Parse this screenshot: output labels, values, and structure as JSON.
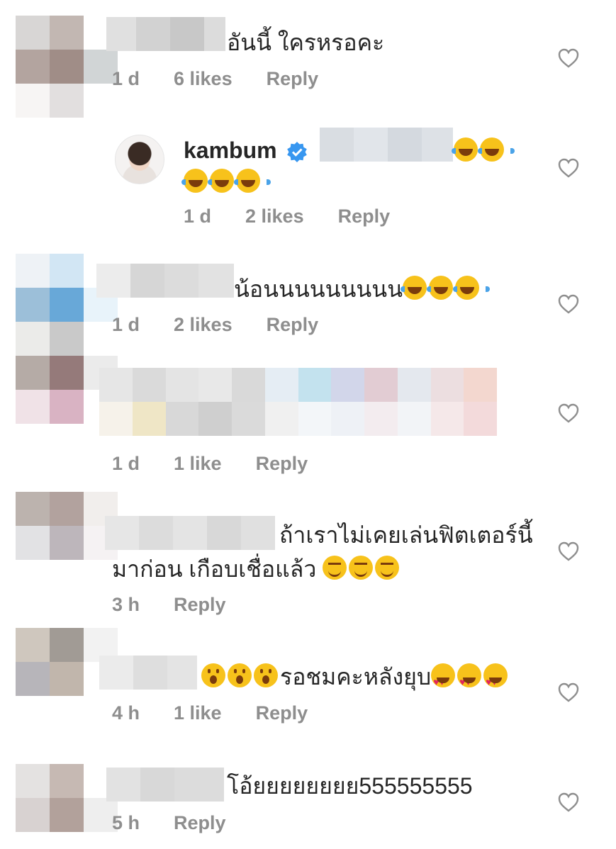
{
  "comments": [
    {
      "avatar_colors": [
        "#d8d6d5",
        "#c2b7b2",
        "#ffffff",
        "#b3a49f",
        "#a08d87",
        "#d1d5d6",
        "#f7f5f4",
        "#e2dfdf",
        "#ffffff"
      ],
      "name_blur_colors": [
        "#e0e0e0",
        "#d2d2d2",
        "#c8c8c8",
        "#dcdcdc"
      ],
      "text": "อันนี้ ใครหรอคะ",
      "time": "1 d",
      "likes": "6 likes",
      "reply": "Reply"
    },
    {
      "username": "kambum",
      "name_blur_colors": [
        "#d9dde2",
        "#e1e5ea",
        "#d4d9df",
        "#dde1e6"
      ],
      "emojis_line1": [
        "laugh",
        "laugh"
      ],
      "emojis_line2": [
        "laugh",
        "laugh",
        "laugh"
      ],
      "time": "1 d",
      "likes": "2 likes",
      "reply": "Reply"
    },
    {
      "avatar_colors": [
        "#eef2f6",
        "#d2e6f4",
        "#ffffff",
        "#9cbfd9",
        "#68a8d8",
        "#e8f3fa",
        "#ebebe9",
        "#c9c9c9",
        "#ffffff"
      ],
      "name_blur_colors": [
        "#ececec",
        "#d6d6d6",
        "#dcdcdc",
        "#e2e2e2"
      ],
      "text": "น้อนนนนนนนนน",
      "emojis": [
        "laugh",
        "laugh",
        "laugh"
      ],
      "time": "1 d",
      "likes": "2 likes",
      "reply": "Reply"
    },
    {
      "avatar_colors": [
        "#b5aba6",
        "#957a7a",
        "#ebebeb",
        "#f0e2e7",
        "#d9b3c3",
        "#ffffff",
        "#ffffff",
        "#ffffff",
        "#ffffff"
      ],
      "time": "1 d",
      "likes": "1 like",
      "reply": "Reply"
    },
    {
      "avatar_colors": [
        "#bcb3ae",
        "#b2a29e",
        "#f1eeec",
        "#e2e2e4",
        "#bdb6bb",
        "#f5f2f3",
        "#ffffff",
        "#ffffff",
        "#ffffff"
      ],
      "name_blur_colors": [
        "#e6e6e6",
        "#dcdcdc",
        "#e4e4e4",
        "#d8d8d8",
        "#e0e0e0"
      ],
      "text_line1": "ถ้าเราไม่เคยเล่นฟิตเตอร์นี้",
      "text_line2": "มาก่อน เกือบเชื่อแล้ว",
      "emojis": [
        "wink",
        "wink",
        "wink"
      ],
      "time": "3 h",
      "reply": "Reply"
    },
    {
      "avatar_colors": [
        "#cfc7be",
        "#a19b95",
        "#f2f2f2",
        "#b7b5ba",
        "#c1b6ac",
        "#ffffff",
        "#ffffff",
        "#ffffff",
        "#ffffff"
      ],
      "name_blur_colors": [
        "#ebebeb",
        "#dedede",
        "#e4e4e4"
      ],
      "emojis_before": [
        "wow",
        "wow",
        "wow"
      ],
      "text": "รอชมคะหลังยุบ",
      "emojis_after": [
        "love",
        "love",
        "love"
      ],
      "time": "4 h",
      "likes": "1 like",
      "reply": "Reply"
    },
    {
      "avatar_colors": [
        "#e4e2e1",
        "#c6b9b3",
        "#ffffff",
        "#d8d2d1",
        "#b2a19b",
        "#eeeeee",
        "#ffffff",
        "#ffffff",
        "#ffffff"
      ],
      "name_blur_colors": [
        "#e2e2e2",
        "#d8d8d8",
        "#dcdcdc"
      ],
      "text": "โอ้ยยยยยยยย555555555",
      "time": "5 h",
      "reply": "Reply"
    }
  ],
  "blur_strip_colors": {
    "top": [
      "#e6e6e6",
      "#dadada",
      "#e4e4e4",
      "#e8e8e8",
      "#d9d9d9",
      "#e5edf4",
      "#c3e2ee",
      "#d2d6ea",
      "#e2ccd3",
      "#e4e8ee",
      "#ecdee0",
      "#f3d7cf"
    ],
    "bottom": [
      "#f6f2ea",
      "#efe6c6",
      "#d8d8d8",
      "#cfcfcf",
      "#dadada",
      "#f0f0f0",
      "#f3f6f9",
      "#eef1f6",
      "#f3ecef",
      "#f2f4f7",
      "#f5e8e9",
      "#f3dadb"
    ]
  },
  "colors": {
    "text": "#262626",
    "meta": "#8e8e8e",
    "verified": "#3897f0",
    "heart_stroke": "#8e8e8e"
  },
  "icons": {
    "heart": "heart-outline-icon",
    "verified": "verified-badge-icon"
  }
}
